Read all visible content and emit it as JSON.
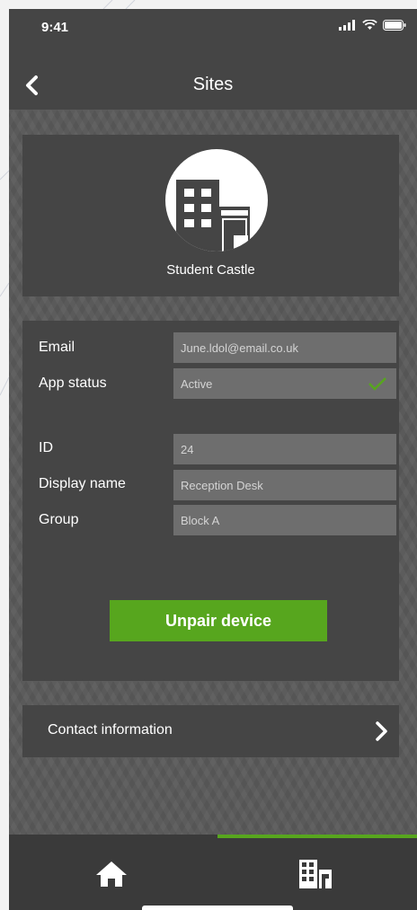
{
  "status_bar": {
    "time": "9:41"
  },
  "header": {
    "title": "Sites"
  },
  "site": {
    "name": "Student Castle"
  },
  "details": {
    "email_label": "Email",
    "email_value": "June.ldol@email.co.uk",
    "app_status_label": "App status",
    "app_status_value": "Active",
    "id_label": "ID",
    "id_value": "24",
    "display_name_label": "Display name",
    "display_name_value": "Reception Desk",
    "group_label": "Group",
    "group_value": "Block A",
    "unpair_label": "Unpair device"
  },
  "contact": {
    "label": "Contact information"
  },
  "tabbar": {
    "active_tab": "sites"
  },
  "colors": {
    "accent": "#57a61e",
    "panel": "#454545",
    "field": "#6e6e6e"
  },
  "icons": [
    "signal-icon",
    "wifi-icon",
    "battery-icon",
    "back-chevron-icon",
    "building-icon",
    "check-icon",
    "chevron-right-icon",
    "home-icon",
    "sites-icon"
  ]
}
